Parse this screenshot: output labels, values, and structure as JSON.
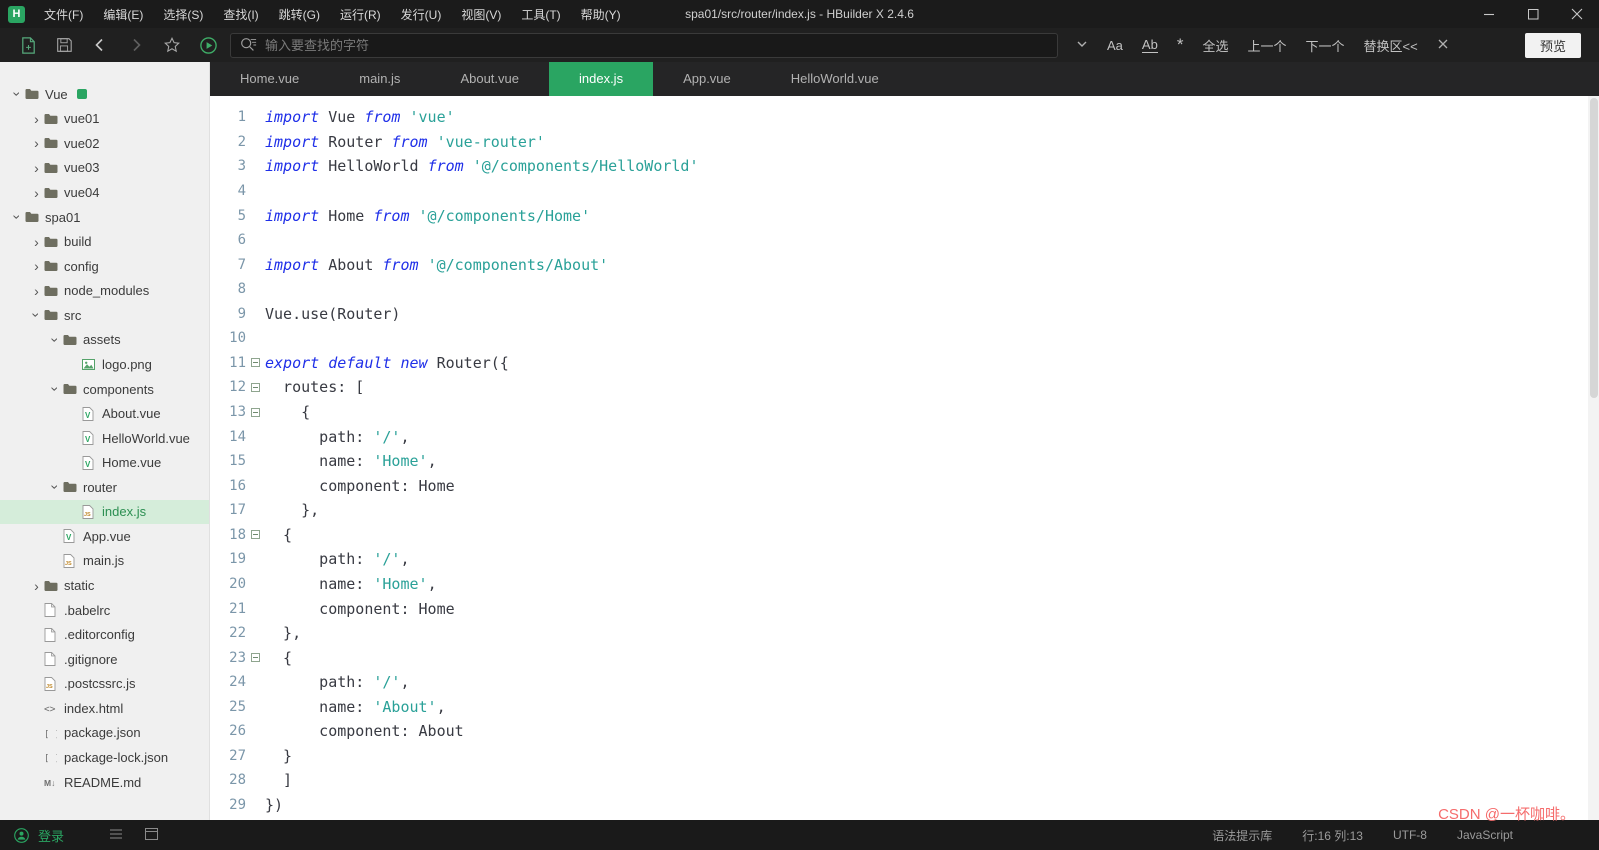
{
  "window": {
    "logo_text": "H",
    "menus": [
      "文件(F)",
      "编辑(E)",
      "选择(S)",
      "查找(I)",
      "跳转(G)",
      "运行(R)",
      "发行(U)",
      "视图(V)",
      "工具(T)",
      "帮助(Y)"
    ],
    "title": "spa01/src/router/index.js - HBuilder X 2.4.6"
  },
  "toolbar": {
    "search_placeholder": "输入要查找的字符",
    "match_case_label": "Aa",
    "whole_word_label": "Ab",
    "regex_label": "*",
    "select_all_label": "全选",
    "prev_label": "上一个",
    "next_label": "下一个",
    "replace_label": "替换区<<",
    "preview_label": "预览"
  },
  "tabs": [
    {
      "label": "Home.vue",
      "active": false
    },
    {
      "label": "main.js",
      "active": false
    },
    {
      "label": "About.vue",
      "active": false
    },
    {
      "label": "index.js",
      "active": true
    },
    {
      "label": "App.vue",
      "active": false
    },
    {
      "label": "HelloWorld.vue",
      "active": false
    }
  ],
  "sidebar": {
    "login_label": "登录",
    "tree": [
      {
        "depth": 0,
        "chev": "v",
        "icon": "folder",
        "label": "Vue",
        "badge": true
      },
      {
        "depth": 1,
        "chev": ">",
        "icon": "folder",
        "label": "vue01"
      },
      {
        "depth": 1,
        "chev": ">",
        "icon": "folder",
        "label": "vue02"
      },
      {
        "depth": 1,
        "chev": ">",
        "icon": "folder",
        "label": "vue03"
      },
      {
        "depth": 1,
        "chev": ">",
        "icon": "folder",
        "label": "vue04"
      },
      {
        "depth": 0,
        "chev": "v",
        "icon": "folder",
        "label": "spa01"
      },
      {
        "depth": 1,
        "chev": ">",
        "icon": "folder",
        "label": "build"
      },
      {
        "depth": 1,
        "chev": ">",
        "icon": "folder",
        "label": "config"
      },
      {
        "depth": 1,
        "chev": ">",
        "icon": "folder",
        "label": "node_modules"
      },
      {
        "depth": 1,
        "chev": "v",
        "icon": "folder",
        "label": "src"
      },
      {
        "depth": 2,
        "chev": "v",
        "icon": "folder",
        "label": "assets"
      },
      {
        "depth": 3,
        "chev": "",
        "icon": "image",
        "label": "logo.png"
      },
      {
        "depth": 2,
        "chev": "v",
        "icon": "folder",
        "label": "components"
      },
      {
        "depth": 3,
        "chev": "",
        "icon": "vue",
        "label": "About.vue"
      },
      {
        "depth": 3,
        "chev": "",
        "icon": "vue",
        "label": "HelloWorld.vue"
      },
      {
        "depth": 3,
        "chev": "",
        "icon": "vue",
        "label": "Home.vue"
      },
      {
        "depth": 2,
        "chev": "v",
        "icon": "folder",
        "label": "router"
      },
      {
        "depth": 3,
        "chev": "",
        "icon": "js",
        "label": "index.js",
        "selected": true
      },
      {
        "depth": 2,
        "chev": "",
        "icon": "vue",
        "label": "App.vue"
      },
      {
        "depth": 2,
        "chev": "",
        "icon": "js",
        "label": "main.js"
      },
      {
        "depth": 1,
        "chev": ">",
        "icon": "folder",
        "label": "static"
      },
      {
        "depth": 1,
        "chev": "",
        "icon": "file",
        "label": ".babelrc"
      },
      {
        "depth": 1,
        "chev": "",
        "icon": "file",
        "label": ".editorconfig"
      },
      {
        "depth": 1,
        "chev": "",
        "icon": "file",
        "label": ".gitignore"
      },
      {
        "depth": 1,
        "chev": "",
        "icon": "js",
        "label": ".postcssrc.js"
      },
      {
        "depth": 1,
        "chev": "",
        "icon": "html",
        "label": "index.html"
      },
      {
        "depth": 1,
        "chev": "",
        "icon": "json",
        "label": "package.json"
      },
      {
        "depth": 1,
        "chev": "",
        "icon": "json",
        "label": "package-lock.json"
      },
      {
        "depth": 1,
        "chev": "",
        "icon": "md",
        "label": "README.md"
      }
    ]
  },
  "editor": {
    "lines": [
      {
        "n": 1,
        "fold": false,
        "tokens": [
          {
            "c": "kw",
            "t": "import"
          },
          {
            "c": "pln",
            "t": " Vue "
          },
          {
            "c": "kw",
            "t": "from"
          },
          {
            "c": "pln",
            "t": " "
          },
          {
            "c": "str",
            "t": "'vue'"
          }
        ]
      },
      {
        "n": 2,
        "fold": false,
        "tokens": [
          {
            "c": "kw",
            "t": "import"
          },
          {
            "c": "pln",
            "t": " Router "
          },
          {
            "c": "kw",
            "t": "from"
          },
          {
            "c": "pln",
            "t": " "
          },
          {
            "c": "str",
            "t": "'vue-router'"
          }
        ]
      },
      {
        "n": 3,
        "fold": false,
        "tokens": [
          {
            "c": "kw",
            "t": "import"
          },
          {
            "c": "pln",
            "t": " HelloWorld "
          },
          {
            "c": "kw",
            "t": "from"
          },
          {
            "c": "pln",
            "t": " "
          },
          {
            "c": "str",
            "t": "'@/components/HelloWorld'"
          }
        ]
      },
      {
        "n": 4,
        "fold": false,
        "tokens": []
      },
      {
        "n": 5,
        "fold": false,
        "tokens": [
          {
            "c": "kw",
            "t": "import"
          },
          {
            "c": "pln",
            "t": " Home "
          },
          {
            "c": "kw",
            "t": "from"
          },
          {
            "c": "pln",
            "t": " "
          },
          {
            "c": "str",
            "t": "'@/components/Home'"
          }
        ]
      },
      {
        "n": 6,
        "fold": false,
        "tokens": []
      },
      {
        "n": 7,
        "fold": false,
        "tokens": [
          {
            "c": "kw",
            "t": "import"
          },
          {
            "c": "pln",
            "t": " About "
          },
          {
            "c": "kw",
            "t": "from"
          },
          {
            "c": "pln",
            "t": " "
          },
          {
            "c": "str",
            "t": "'@/components/About'"
          }
        ]
      },
      {
        "n": 8,
        "fold": false,
        "tokens": []
      },
      {
        "n": 9,
        "fold": false,
        "tokens": [
          {
            "c": "pln",
            "t": "Vue.use(Router)"
          }
        ]
      },
      {
        "n": 10,
        "fold": false,
        "tokens": []
      },
      {
        "n": 11,
        "fold": true,
        "tokens": [
          {
            "c": "kw",
            "t": "export"
          },
          {
            "c": "pln",
            "t": " "
          },
          {
            "c": "kw",
            "t": "default"
          },
          {
            "c": "pln",
            "t": " "
          },
          {
            "c": "kw",
            "t": "new"
          },
          {
            "c": "pln",
            "t": " Router({"
          }
        ]
      },
      {
        "n": 12,
        "fold": true,
        "tokens": [
          {
            "c": "pln",
            "t": "  routes: ["
          }
        ]
      },
      {
        "n": 13,
        "fold": true,
        "tokens": [
          {
            "c": "pln",
            "t": "    {"
          }
        ]
      },
      {
        "n": 14,
        "fold": false,
        "tokens": [
          {
            "c": "pln",
            "t": "      path: "
          },
          {
            "c": "str",
            "t": "'/'"
          },
          {
            "c": "pln",
            "t": ","
          }
        ]
      },
      {
        "n": 15,
        "fold": false,
        "tokens": [
          {
            "c": "pln",
            "t": "      name: "
          },
          {
            "c": "str",
            "t": "'Home'"
          },
          {
            "c": "pln",
            "t": ","
          }
        ]
      },
      {
        "n": 16,
        "fold": false,
        "tokens": [
          {
            "c": "pln",
            "t": "      component: Home"
          }
        ]
      },
      {
        "n": 17,
        "fold": false,
        "tokens": [
          {
            "c": "pln",
            "t": "    },"
          }
        ]
      },
      {
        "n": 18,
        "fold": true,
        "tokens": [
          {
            "c": "pln",
            "t": "  {"
          }
        ]
      },
      {
        "n": 19,
        "fold": false,
        "tokens": [
          {
            "c": "pln",
            "t": "      path: "
          },
          {
            "c": "str",
            "t": "'/'"
          },
          {
            "c": "pln",
            "t": ","
          }
        ]
      },
      {
        "n": 20,
        "fold": false,
        "tokens": [
          {
            "c": "pln",
            "t": "      name: "
          },
          {
            "c": "str",
            "t": "'Home'"
          },
          {
            "c": "pln",
            "t": ","
          }
        ]
      },
      {
        "n": 21,
        "fold": false,
        "tokens": [
          {
            "c": "pln",
            "t": "      component: Home"
          }
        ]
      },
      {
        "n": 22,
        "fold": false,
        "tokens": [
          {
            "c": "pln",
            "t": "  },"
          }
        ]
      },
      {
        "n": 23,
        "fold": true,
        "tokens": [
          {
            "c": "pln",
            "t": "  {"
          }
        ]
      },
      {
        "n": 24,
        "fold": false,
        "tokens": [
          {
            "c": "pln",
            "t": "      path: "
          },
          {
            "c": "str",
            "t": "'/'"
          },
          {
            "c": "pln",
            "t": ","
          }
        ]
      },
      {
        "n": 25,
        "fold": false,
        "tokens": [
          {
            "c": "pln",
            "t": "      name: "
          },
          {
            "c": "str",
            "t": "'About'"
          },
          {
            "c": "pln",
            "t": ","
          }
        ]
      },
      {
        "n": 26,
        "fold": false,
        "tokens": [
          {
            "c": "pln",
            "t": "      component: About"
          }
        ]
      },
      {
        "n": 27,
        "fold": false,
        "tokens": [
          {
            "c": "pln",
            "t": "  }"
          }
        ]
      },
      {
        "n": 28,
        "fold": false,
        "tokens": [
          {
            "c": "pln",
            "t": "  ]"
          }
        ]
      },
      {
        "n": 29,
        "fold": false,
        "tokens": [
          {
            "c": "pln",
            "t": "})"
          }
        ]
      }
    ]
  },
  "statusbar": {
    "items": [
      "语法提示库",
      "行:16  列:13",
      "UTF-8",
      "JavaScript"
    ]
  },
  "watermark": "CSDN @一杯咖啡。",
  "icons": {
    "app-logo": "green H square",
    "new-file-icon": "document-plus",
    "save-icon": "floppy",
    "back-icon": "chevron-left",
    "forward-icon": "chevron-right",
    "favorite-icon": "star",
    "run-icon": "play-circle",
    "advanced-search-icon": "magnifier-lines",
    "search-history-dropdown-icon": "chevron-down",
    "close-search-icon": "x",
    "minimize-icon": "dash",
    "maximize-icon": "square",
    "close-icon": "x",
    "folder-icon": "folder",
    "vue-file-icon": "doc-V",
    "js-file-icon": "doc-JS",
    "image-file-icon": "picture",
    "html-file-icon": "angle-brackets",
    "json-file-icon": "brackets",
    "md-file-icon": "M-arrow",
    "file-icon": "doc",
    "login-icon": "person-circle",
    "outline-list-icon": "lines",
    "console-panel-icon": "window"
  },
  "colors": {
    "accent_green": "#2aa562",
    "keyword": "#1f2fe8",
    "string": "#2aa198",
    "code_text": "#383a42",
    "line_number": "#7b96a9",
    "active_tab_bg": "#2aa562",
    "selected_row_bg": "#d5edda",
    "sidebar_bg": "#f0f0f0",
    "dark_bg": "#1b1b1b",
    "watermark_color": "#f56c6c"
  }
}
